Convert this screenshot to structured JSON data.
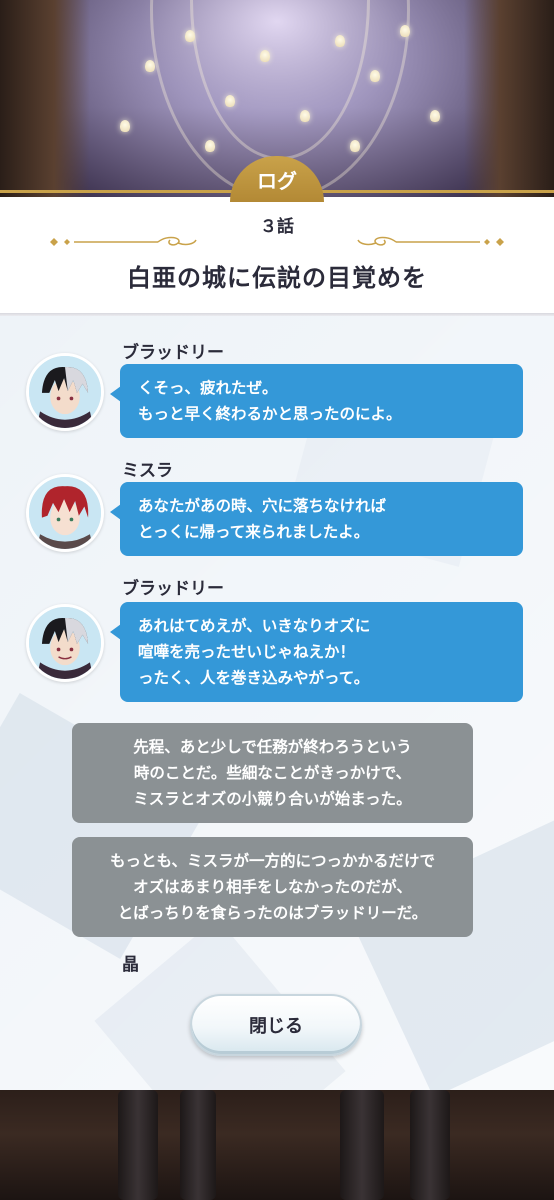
{
  "header": {
    "tab_label": "ログ",
    "episode_number": "３話",
    "episode_title": "白亜の城に伝説の目覚めを"
  },
  "log": {
    "entries": [
      {
        "type": "dialogue",
        "speaker": "ブラッドリー",
        "avatar_icon": "bradley-avatar-icon",
        "lines": [
          "くそっ、疲れたぜ。",
          "もっと早く終わるかと思ったのによ。"
        ]
      },
      {
        "type": "dialogue",
        "speaker": "ミスラ",
        "avatar_icon": "mithra-avatar-icon",
        "lines": [
          "あなたがあの時、穴に落ちなければ",
          "とっくに帰って来られましたよ。"
        ]
      },
      {
        "type": "dialogue",
        "speaker": "ブラッドリー",
        "avatar_icon": "bradley-avatar-icon",
        "lines": [
          "あれはてめえが、いきなりオズに",
          "喧嘩を売ったせいじゃねえか！",
          "ったく、人を巻き込みやがって。"
        ]
      },
      {
        "type": "narration",
        "lines": [
          "先程、あと少しで任務が終わろうという",
          "時のことだ。些細なことがきっかけで、",
          "ミスラとオズの小競り合いが始まった。"
        ]
      },
      {
        "type": "narration",
        "lines": [
          "もっとも、ミスラが一方的につっかかるだけで",
          "オズはあまり相手をしなかったのだが、",
          "とばっちりを食らったのはブラッドリーだ。"
        ]
      },
      {
        "type": "dialogue",
        "speaker": "晶"
      }
    ]
  },
  "close_button": {
    "label": "閉じる"
  },
  "colors": {
    "accent_gold": "#c9a24a",
    "dialogue_bubble": "#3498d8",
    "narration_box": "#8b9194",
    "text_dark": "#2b2b3a"
  }
}
